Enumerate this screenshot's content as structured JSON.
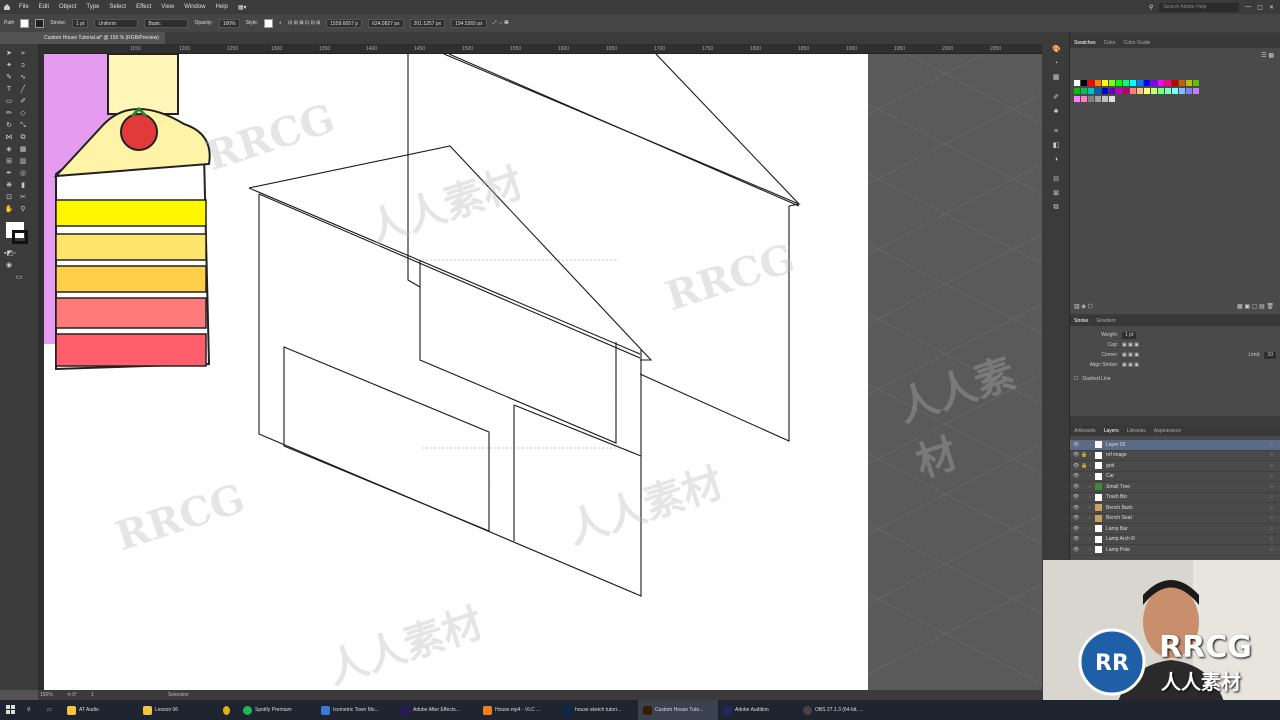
{
  "menu": {
    "items": [
      "File",
      "Edit",
      "Object",
      "Type",
      "Select",
      "Effect",
      "View",
      "Window",
      "Help"
    ],
    "search_placeholder": "Search Adobe Help"
  },
  "control": {
    "selection_label": "Path",
    "stroke_label": "Stroke:",
    "stroke_value": "1 pt",
    "profile_value": "Uniform",
    "brush_value": "Basic",
    "opacity_label": "Opacity:",
    "opacity_value": "100%",
    "style_label": "Style:",
    "x_value": "1559.6057 p",
    "y_value": "624.0827 px",
    "w_value": "201.1257 px",
    "h_value": "194.5265 px"
  },
  "document_tab": "Custom House Tutorial.ai* @ 150 % (RGB/Preview)",
  "ruler_ticks": [
    "1150",
    "1200",
    "1250",
    "1300",
    "1350",
    "1400",
    "1450",
    "1500",
    "1550",
    "1600",
    "1650",
    "1700",
    "1750",
    "1800",
    "1850",
    "1900",
    "1950",
    "2000",
    "2050"
  ],
  "status": {
    "zoom": "150%",
    "artboard_index": "1",
    "mode": "Selection"
  },
  "swatches_panel": {
    "tabs": [
      "Swatches",
      "Color",
      "Color Guide"
    ],
    "colors": [
      "#ffffff",
      "#000000",
      "#ff0000",
      "#ff8000",
      "#ffff00",
      "#80ff00",
      "#00ff00",
      "#00ff80",
      "#00ffff",
      "#0080ff",
      "#0000ff",
      "#8000ff",
      "#ff00ff",
      "#ff0080",
      "#c00000",
      "#c06000",
      "#c0c000",
      "#60c000",
      "#00c000",
      "#00c060",
      "#00c0c0",
      "#0060c0",
      "#0000c0",
      "#6000c0",
      "#c000c0",
      "#c00060",
      "#ff8080",
      "#ffc080",
      "#ffff80",
      "#c0ff80",
      "#80ff80",
      "#80ffc0",
      "#80ffff",
      "#80c0ff",
      "#8080ff",
      "#c080ff",
      "#ff80ff",
      "#ff80c0",
      "#808080",
      "#a0a0a0",
      "#c0c0c0",
      "#e0e0e0"
    ]
  },
  "stroke_panel": {
    "tabs": [
      "Stroke",
      "Gradient"
    ],
    "weight_label": "Weight:",
    "weight_value": "1 pt",
    "cap_label": "Cap:",
    "corner_label": "Corner:",
    "limit_label": "Limit:",
    "limit_value": "10",
    "align_label": "Align Stroke:",
    "dashed_label": "Dashed Line"
  },
  "layers_panel": {
    "tabs": [
      "Artboards",
      "Layers",
      "Libraries",
      "Appearance"
    ],
    "rows": [
      "Layer 55",
      "ref image",
      "grid",
      "Car",
      "Small Tree",
      "Trash Bin",
      "Bench Back",
      "Bench Seat",
      "Lamp Bar",
      "Lamp Arch R",
      "Lamp Pole"
    ]
  },
  "taskbar": {
    "items": [
      "AT Audio",
      "Lesson 06",
      "",
      "Spotify Premium",
      "Isometric Town Mo...",
      "Adobe After Effects...",
      "House.mp4 - VLC ...",
      "house sketch tutori...",
      "Custom House Tuto...",
      "Adobe Audition",
      "OBS 27.1.3 (64-bit, ..."
    ]
  },
  "watermarks": [
    "RRCG",
    "人人素材"
  ],
  "logo": {
    "brand": "RRCG",
    "sub": "人人素材"
  }
}
